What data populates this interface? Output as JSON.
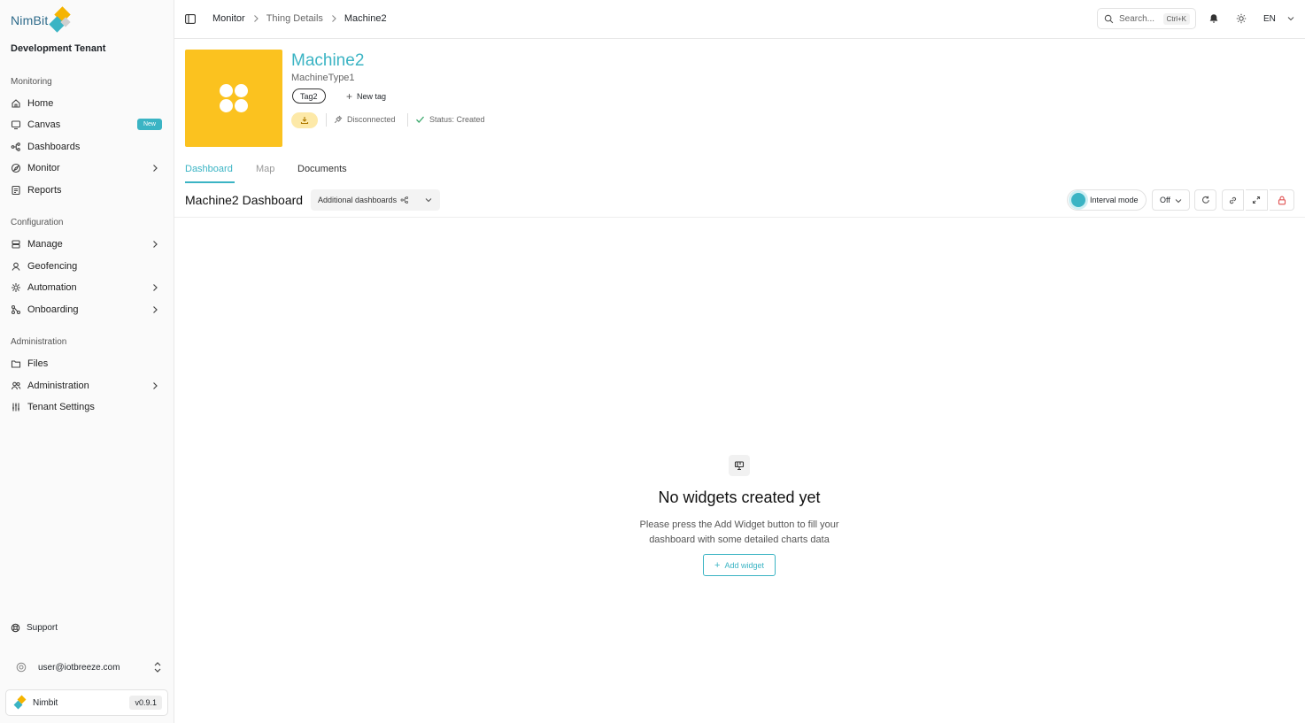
{
  "app": {
    "logo_text": "NimBit",
    "tenant": "Development Tenant",
    "version": "v0.9.1",
    "product": "Nimbit"
  },
  "sidebar": {
    "sections": [
      {
        "label": "Monitoring"
      },
      {
        "label": "Configuration"
      },
      {
        "label": "Administration"
      }
    ],
    "items": [
      {
        "label": "Home",
        "icon": "home-icon"
      },
      {
        "label": "Canvas",
        "icon": "canvas-icon",
        "badge": "New"
      },
      {
        "label": "Dashboards",
        "icon": "dashboards-icon"
      },
      {
        "label": "Monitor",
        "icon": "monitor-icon",
        "has_children": true
      },
      {
        "label": "Reports",
        "icon": "reports-icon"
      },
      {
        "label": "Manage",
        "icon": "manage-icon",
        "has_children": true
      },
      {
        "label": "Geofencing",
        "icon": "geofencing-icon"
      },
      {
        "label": "Automation",
        "icon": "automation-icon",
        "has_children": true
      },
      {
        "label": "Onboarding",
        "icon": "onboarding-icon",
        "has_children": true
      },
      {
        "label": "Files",
        "icon": "folder-icon"
      },
      {
        "label": "Administration",
        "icon": "users-icon",
        "has_children": true
      },
      {
        "label": "Tenant Settings",
        "icon": "sliders-icon"
      }
    ],
    "support": "Support",
    "user_email": "user@iotbreeze.com"
  },
  "header": {
    "breadcrumb": [
      "Monitor",
      "Thing Details",
      "Machine2"
    ],
    "search_placeholder": "Search...",
    "search_shortcut": "Ctrl+K",
    "language": "EN"
  },
  "thing": {
    "name": "Machine2",
    "type": "MachineType1",
    "tags": [
      "Tag2"
    ],
    "new_tag_label": "New tag",
    "connection": "Disconnected",
    "status": "Status: Created",
    "tile_color": "#fbc21f"
  },
  "tabs": [
    {
      "label": "Dashboard",
      "active": true
    },
    {
      "label": "Map",
      "active": false
    },
    {
      "label": "Documents",
      "active": false
    }
  ],
  "dashboard": {
    "title": "Machine2 Dashboard",
    "additional_label": "Additional dashboards",
    "interval_label": "Interval mode",
    "refresh_value": "Off",
    "empty_title": "No widgets created yet",
    "empty_desc_line1": "Please press the Add Widget button to fill your",
    "empty_desc_line2": "dashboard with some detailed charts data",
    "add_widget_label": "Add widget"
  },
  "colors": {
    "accent": "#3bb4c4",
    "brand_yellow": "#f5b400",
    "danger": "#e05252"
  }
}
